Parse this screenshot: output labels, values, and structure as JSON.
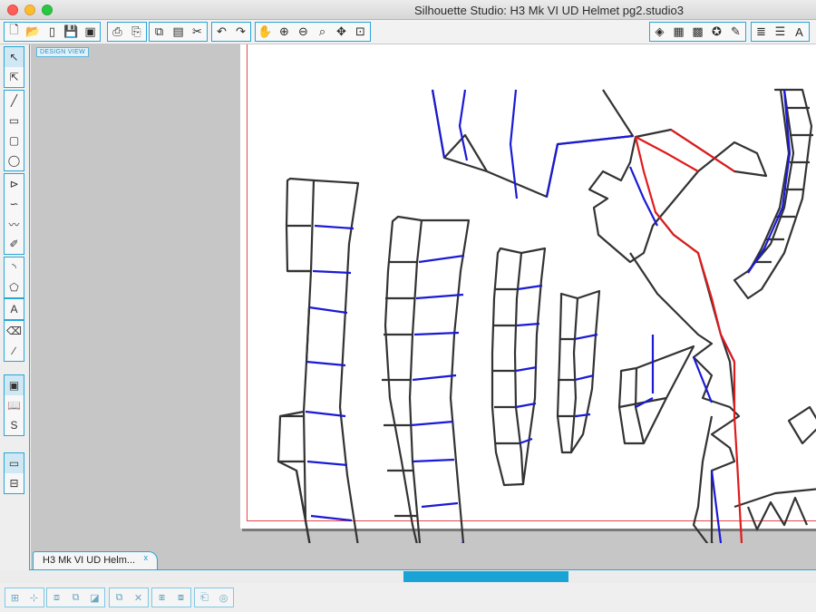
{
  "window": {
    "title": "Silhouette Studio: H3 Mk VI UD Helmet pg2.studio3",
    "controls": [
      "close",
      "minimize",
      "zoom"
    ]
  },
  "toolbar": {
    "file_tools": [
      {
        "icon": "new-document-icon",
        "glyph": "🗋"
      },
      {
        "icon": "open-folder-icon",
        "glyph": "📂"
      },
      {
        "icon": "open-file-icon",
        "glyph": "▯"
      },
      {
        "icon": "save-icon",
        "glyph": "💾"
      },
      {
        "icon": "save-as-icon",
        "glyph": "▣"
      }
    ],
    "print_tools": [
      {
        "icon": "print-icon",
        "glyph": "⎙"
      },
      {
        "icon": "print-cut-icon",
        "glyph": "⎘"
      }
    ],
    "edit_tools": [
      {
        "icon": "copy-icon",
        "glyph": "⧉"
      },
      {
        "icon": "paste-icon",
        "glyph": "▤"
      },
      {
        "icon": "cut-icon",
        "glyph": "✂"
      }
    ],
    "history_tools": [
      {
        "icon": "undo-icon",
        "glyph": "↶"
      },
      {
        "icon": "redo-icon",
        "glyph": "↷"
      }
    ],
    "view_tools": [
      {
        "icon": "pan-hand-icon",
        "glyph": "✋"
      },
      {
        "icon": "zoom-in-icon",
        "glyph": "⊕"
      },
      {
        "icon": "zoom-out-icon",
        "glyph": "⊖"
      },
      {
        "icon": "zoom-box-icon",
        "glyph": "⌕"
      },
      {
        "icon": "zoom-drag-icon",
        "glyph": "✥"
      },
      {
        "icon": "fit-to-page-icon",
        "glyph": "⊡"
      }
    ],
    "panel_tools": [
      {
        "icon": "fill-color-icon",
        "glyph": "◈"
      },
      {
        "icon": "gradient-icon",
        "glyph": "▦"
      },
      {
        "icon": "fill-pattern-icon",
        "glyph": "▩"
      },
      {
        "icon": "line-color-icon",
        "glyph": "✪"
      },
      {
        "icon": "line-style-icon",
        "glyph": "✎"
      }
    ],
    "right_tools": [
      {
        "icon": "cut-settings-icon",
        "glyph": "≣"
      },
      {
        "icon": "line-settings-icon",
        "glyph": "☰"
      },
      {
        "icon": "text-style-icon",
        "glyph": "A"
      }
    ]
  },
  "left_tools": {
    "select": [
      {
        "icon": "select-arrow-icon",
        "glyph": "↖",
        "active": true
      },
      {
        "icon": "edit-points-icon",
        "glyph": "⇱",
        "active": false
      }
    ],
    "draw": [
      {
        "icon": "line-tool-icon",
        "glyph": "╱"
      },
      {
        "icon": "rectangle-tool-icon",
        "glyph": "▭"
      },
      {
        "icon": "rounded-rectangle-tool-icon",
        "glyph": "▢"
      },
      {
        "icon": "ellipse-tool-icon",
        "glyph": "◯"
      }
    ],
    "path": [
      {
        "icon": "polygon-tool-icon",
        "glyph": "⊳"
      },
      {
        "icon": "curve-tool-icon",
        "glyph": "∽"
      },
      {
        "icon": "freehand-tool-icon",
        "glyph": "〰"
      },
      {
        "icon": "smooth-freehand-tool-icon",
        "glyph": "✐"
      }
    ],
    "shapes": [
      {
        "icon": "arc-tool-icon",
        "glyph": "◝"
      },
      {
        "icon": "regular-polygon-tool-icon",
        "glyph": "⬠"
      }
    ],
    "text": [
      {
        "icon": "text-tool-icon",
        "glyph": "A"
      }
    ],
    "erase": [
      {
        "icon": "eraser-tool-icon",
        "glyph": "⌫"
      },
      {
        "icon": "knife-tool-icon",
        "glyph": "∕"
      }
    ],
    "views": [
      {
        "icon": "design-view-icon",
        "glyph": "▣",
        "active": true
      },
      {
        "icon": "library-icon",
        "glyph": "📖",
        "active": false
      },
      {
        "icon": "silhouette-store-icon",
        "glyph": "S",
        "active": false
      }
    ],
    "windows": [
      {
        "icon": "single-window-icon",
        "glyph": "▭",
        "active": true
      },
      {
        "icon": "split-window-icon",
        "glyph": "⊟",
        "active": false
      }
    ]
  },
  "workspace": {
    "view_label": "DESIGN VIEW"
  },
  "document_tab": {
    "label": "H3 Mk VI UD Helm...",
    "close_glyph": "x"
  },
  "bottom_toolbar": {
    "align": [
      {
        "icon": "align-icon",
        "glyph": "⊞"
      },
      {
        "icon": "center-align-icon",
        "glyph": "⊹"
      }
    ],
    "group": [
      {
        "icon": "group-icon",
        "glyph": "⧈"
      },
      {
        "icon": "ungroup-icon",
        "glyph": "⧉"
      },
      {
        "icon": "compound-path-icon",
        "glyph": "◪"
      }
    ],
    "modify": [
      {
        "icon": "weld-icon",
        "glyph": "⧉"
      },
      {
        "icon": "delete-icon",
        "glyph": "✕"
      }
    ],
    "arrange": [
      {
        "icon": "bring-forward-icon",
        "glyph": "⧆"
      },
      {
        "icon": "send-backward-icon",
        "glyph": "⧇"
      }
    ],
    "other": [
      {
        "icon": "replicate-icon",
        "glyph": "⎗"
      },
      {
        "icon": "offset-icon",
        "glyph": "◎"
      }
    ]
  },
  "colors": {
    "accent": "#28a6d6",
    "cut_line": "#333333",
    "valley_fold": "#1a1ad6",
    "mountain_fold": "#e01b1b",
    "page_margin": "#e8474c"
  }
}
